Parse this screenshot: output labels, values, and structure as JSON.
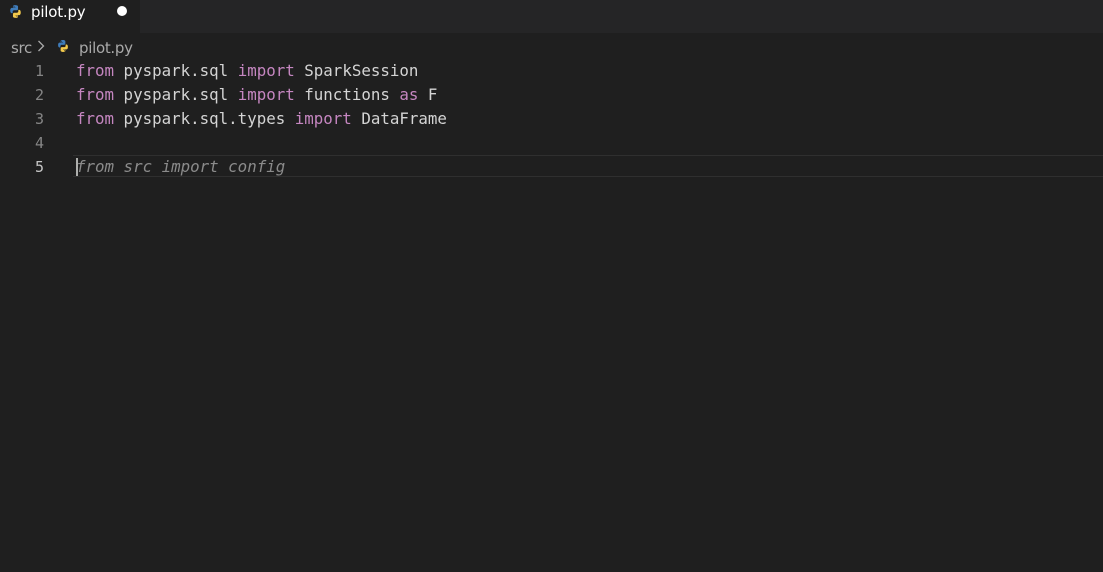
{
  "tab": {
    "label": "pilot.py",
    "icon": "python-icon",
    "dirty": true
  },
  "breadcrumb": {
    "folder": "src",
    "separator_icon": "chevron-right-icon",
    "file_icon": "python-icon",
    "file": "pilot.py"
  },
  "editor": {
    "active_line": 5,
    "lines": [
      {
        "number": "1",
        "tokens": [
          {
            "text": "from",
            "kind": "keyword"
          },
          {
            "text": " pyspark.sql ",
            "kind": "plain"
          },
          {
            "text": "import",
            "kind": "keyword"
          },
          {
            "text": " SparkSession",
            "kind": "plain"
          }
        ]
      },
      {
        "number": "2",
        "tokens": [
          {
            "text": "from",
            "kind": "keyword"
          },
          {
            "text": " pyspark.sql ",
            "kind": "plain"
          },
          {
            "text": "import",
            "kind": "keyword"
          },
          {
            "text": " functions ",
            "kind": "plain"
          },
          {
            "text": "as",
            "kind": "keyword"
          },
          {
            "text": " F",
            "kind": "plain"
          }
        ]
      },
      {
        "number": "3",
        "tokens": [
          {
            "text": "from",
            "kind": "keyword"
          },
          {
            "text": " pyspark.sql.types ",
            "kind": "plain"
          },
          {
            "text": "import",
            "kind": "keyword"
          },
          {
            "text": " DataFrame",
            "kind": "plain"
          }
        ]
      },
      {
        "number": "4",
        "tokens": []
      },
      {
        "number": "5",
        "tokens": [
          {
            "text": "from src import config",
            "kind": "ghost"
          }
        ]
      }
    ]
  },
  "colors": {
    "background": "#1f1f1f",
    "tabbar": "#252526",
    "keyword": "#c586c0",
    "text": "#d4d4d4",
    "ghost": "#8b8b8b",
    "line_number": "#858585",
    "python_blue": "#3f7cba",
    "python_yellow": "#f2c94c"
  }
}
